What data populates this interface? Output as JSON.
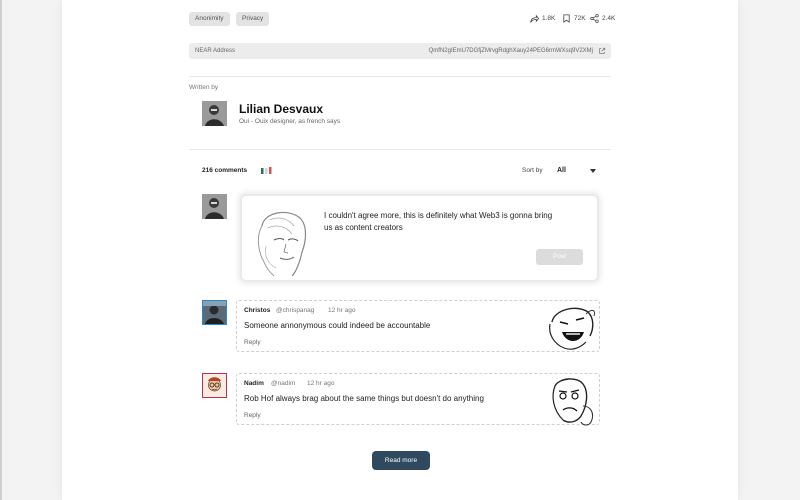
{
  "tags": [
    "Anonimity",
    "Privacy"
  ],
  "stats": {
    "shares": "1.8K",
    "bookmarks": "72K",
    "reposts": "2.4K"
  },
  "near": {
    "label": "NEAR Address",
    "address": "QmfN2gIEmU7DGfjZMrvgRdghXauy24PEG6rmWXsq9V2XMj"
  },
  "author": {
    "written_by": "Written by",
    "name": "Lilian Desvaux",
    "bio": "Oui - Ouix designer, as french says"
  },
  "comments": {
    "count_label": "216 comments",
    "sort_label": "Sort by",
    "sort_value": "All"
  },
  "composer": {
    "text": "I couldn't agree more, this is definitely what Web3 is gonna bring us as content creators",
    "post_label": "Post"
  },
  "comment_list": [
    {
      "name": "Christos",
      "handle": "@chrispanag",
      "time": "12 hr ago",
      "text": "Someone annonymous could indeed be accountable",
      "reply": "Reply"
    },
    {
      "name": "Nadim",
      "handle": "@nadim",
      "time": "12 hr ago",
      "text": "Rob Hof always brag about the same things but doesn't do anything",
      "reply": "Reply"
    }
  ],
  "read_more_label": "Read more",
  "colors": {
    "primary_button": "#2f4a5f",
    "tag_bg": "#e3e3e3"
  }
}
